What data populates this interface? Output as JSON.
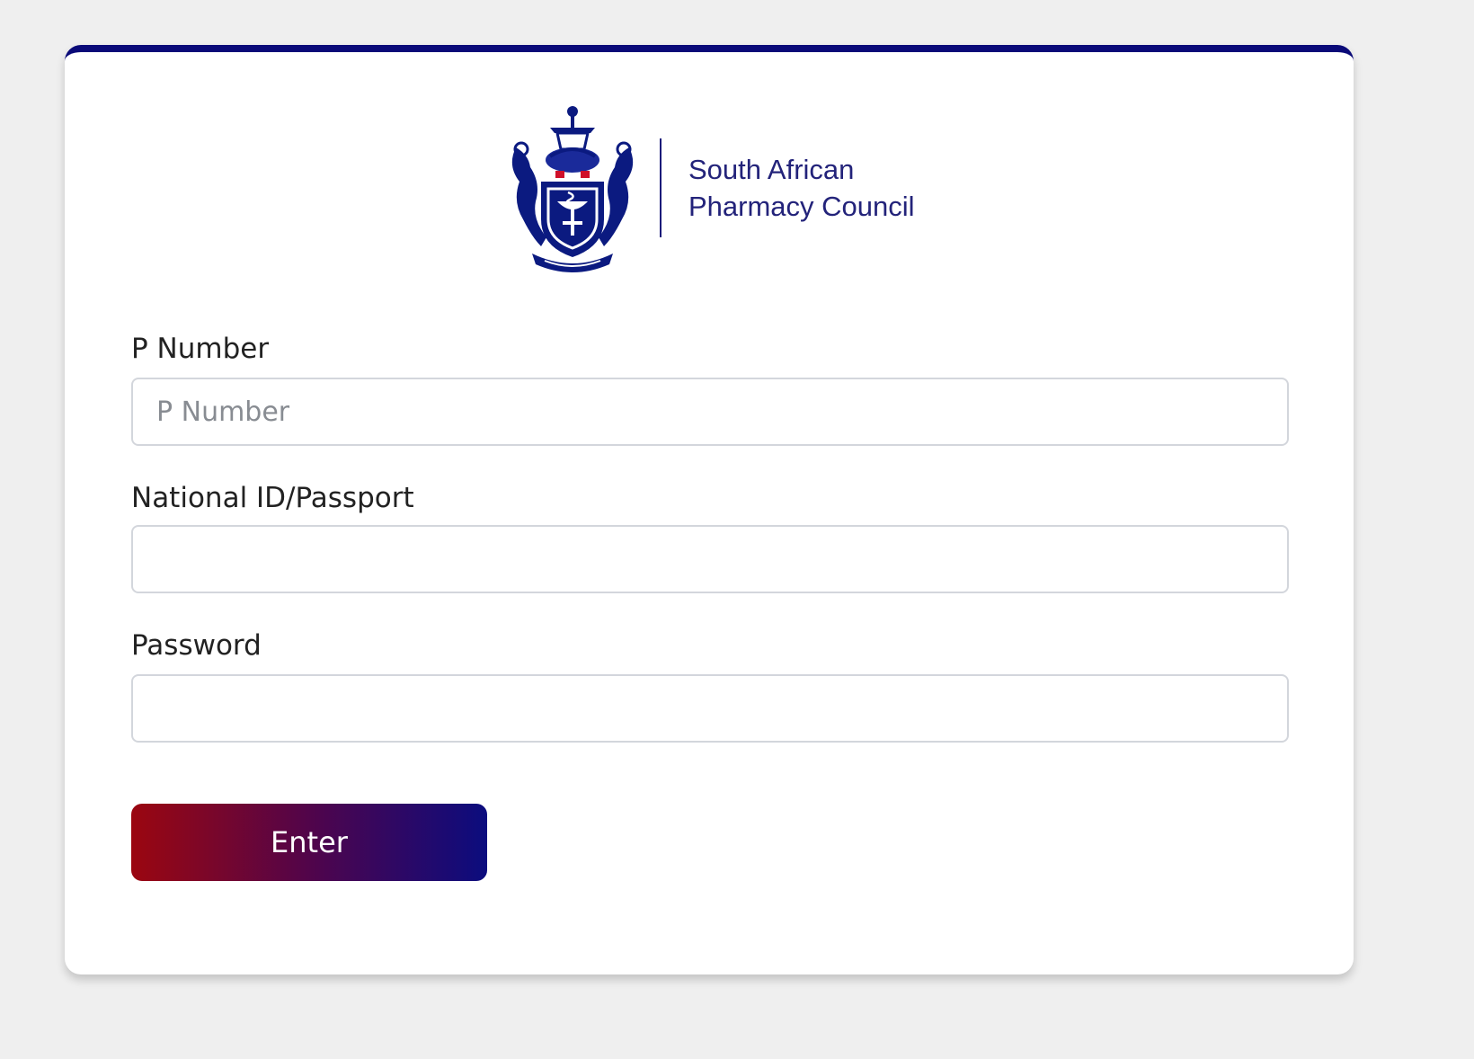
{
  "logo": {
    "line1": "South African",
    "line2": "Pharmacy Council"
  },
  "form": {
    "p_number": {
      "label": "P Number",
      "placeholder": "P Number",
      "value": ""
    },
    "national_id": {
      "label": "National ID/Passport",
      "placeholder": "",
      "value": ""
    },
    "password": {
      "label": "Password",
      "placeholder": "",
      "value": ""
    },
    "submit_label": "Enter"
  },
  "colors": {
    "accent_top_border": "#0a0a78",
    "button_gradient_start": "#9b0610",
    "button_gradient_end": "#0b0c7e",
    "logo_text": "#23237a"
  }
}
